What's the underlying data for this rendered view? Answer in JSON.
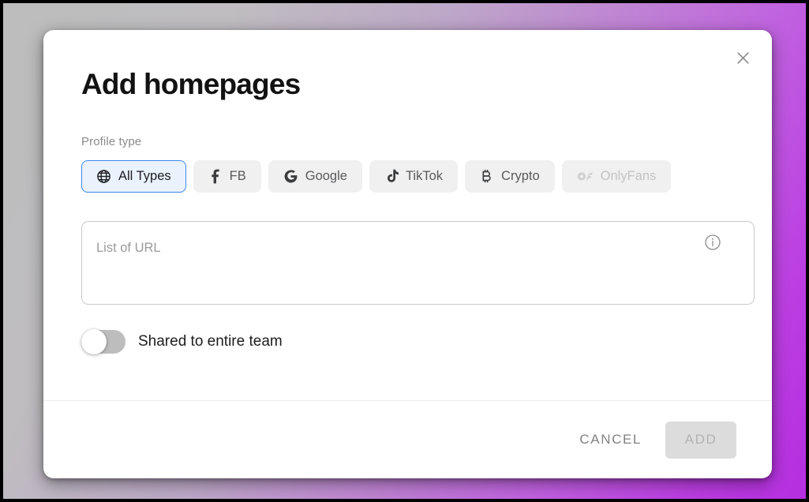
{
  "dialog": {
    "title": "Add homepages",
    "close_icon": "close-icon"
  },
  "profile_type": {
    "label": "Profile type",
    "chips": [
      {
        "label": "All Types",
        "icon": "globe-icon",
        "selected": true,
        "disabled": false
      },
      {
        "label": "FB",
        "icon": "facebook-icon",
        "selected": false,
        "disabled": false
      },
      {
        "label": "Google",
        "icon": "google-icon",
        "selected": false,
        "disabled": false
      },
      {
        "label": "TikTok",
        "icon": "tiktok-icon",
        "selected": false,
        "disabled": false
      },
      {
        "label": "Crypto",
        "icon": "bitcoin-icon",
        "selected": false,
        "disabled": false
      },
      {
        "label": "OnlyFans",
        "icon": "onlyfans-icon",
        "selected": false,
        "disabled": true
      }
    ]
  },
  "url_field": {
    "placeholder": "List of URL",
    "value": "",
    "info_icon": "info-icon"
  },
  "share_toggle": {
    "label": "Shared to entire team",
    "state": "off"
  },
  "footer": {
    "cancel_label": "CANCEL",
    "add_label": "ADD",
    "add_disabled": true
  },
  "colors": {
    "accent_blue": "#3d87ea",
    "chip_selected_bg": "#eaf2fd",
    "chip_bg": "#f0f0f0",
    "backdrop_gray": "#bdbdbd",
    "backdrop_purple": "#b52ee0",
    "dialog_bg": "#ffffff"
  }
}
